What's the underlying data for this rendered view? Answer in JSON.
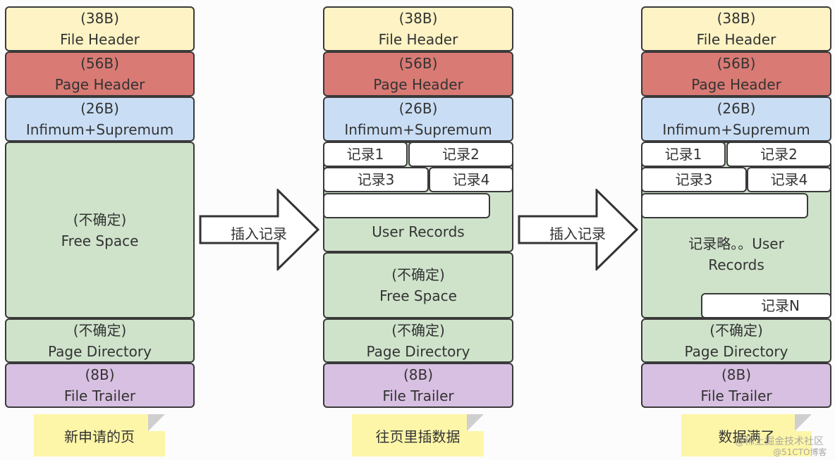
{
  "columns": [
    {
      "header": {
        "size": "(38B)",
        "name": "File Header"
      },
      "page_header": {
        "size": "(56B)",
        "name": "Page Header"
      },
      "infimum": {
        "size": "(26B)",
        "name": "Infimum+Supremum"
      },
      "free_space": {
        "size": "(不确定)",
        "name": "Free Space"
      },
      "page_directory": {
        "size": "(不确定)",
        "name": "Page Directory"
      },
      "trailer": {
        "size": "(8B)",
        "name": "File Trailer"
      },
      "note": "新申请的页"
    },
    {
      "header": {
        "size": "(38B)",
        "name": "File Header"
      },
      "page_header": {
        "size": "(56B)",
        "name": "Page Header"
      },
      "infimum": {
        "size": "(26B)",
        "name": "Infimum+Supremum"
      },
      "records": [
        "记录1",
        "记录2",
        "记录3",
        "记录4"
      ],
      "user_records": "User Records",
      "free_space": {
        "size": "(不确定)",
        "name": "Free Space"
      },
      "page_directory": {
        "size": "(不确定)",
        "name": "Page Directory"
      },
      "trailer": {
        "size": "(8B)",
        "name": "File Trailer"
      },
      "note": "往页里插数据"
    },
    {
      "header": {
        "size": "(38B)",
        "name": "File Header"
      },
      "page_header": {
        "size": "(56B)",
        "name": "Page Header"
      },
      "infimum": {
        "size": "(26B)",
        "name": "Infimum+Supremum"
      },
      "records": [
        "记录1",
        "记录2",
        "记录3",
        "记录4"
      ],
      "user_records": "记录略。。User Records",
      "record_n": "记录N",
      "page_directory": {
        "size": "(不确定)",
        "name": "Page Directory"
      },
      "trailer": {
        "size": "(8B)",
        "name": "File Trailer"
      },
      "note": "数据满了"
    }
  ],
  "arrows": [
    "插入记录",
    "插入记录"
  ],
  "colors": {
    "file_header": "#fdf3c4",
    "page_header": "#d97a74",
    "infimum": "#c9def5",
    "free_space": "#cfe3cb",
    "trailer": "#d8c0e2",
    "note": "#fdf6a8"
  },
  "watermark": [
    "@稀土掘金技术社区",
    "@51CTO博客"
  ]
}
